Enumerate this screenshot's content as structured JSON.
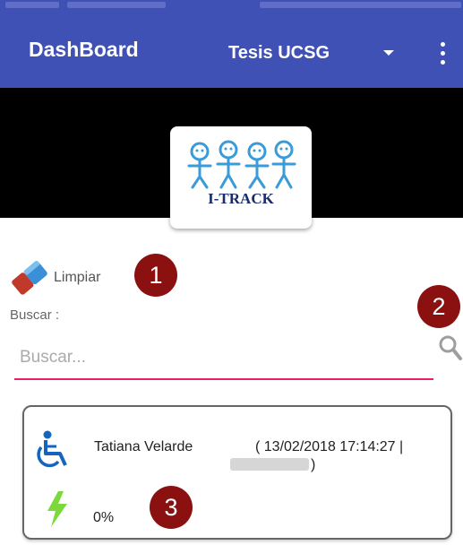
{
  "app_bar": {
    "title": "DashBoard",
    "project": "Tesis UCSG",
    "color": "#3f51b5"
  },
  "logo": {
    "text": "I-TRACK"
  },
  "clear_button": {
    "label": "Limpiar"
  },
  "badges": [
    "1",
    "2",
    "3"
  ],
  "search": {
    "label": "Buscar :",
    "placeholder": "Buscar..."
  },
  "card": {
    "name": "Tatiana Velarde",
    "timestamp": "( 13/02/2018 17:14:27 |",
    "close_paren": ")",
    "progress": "0%"
  },
  "colors": {
    "badge": "#8b1111",
    "input_underline": "#e91e63",
    "wheelchair": "#1565c0",
    "bolt": "#7cd93b"
  }
}
